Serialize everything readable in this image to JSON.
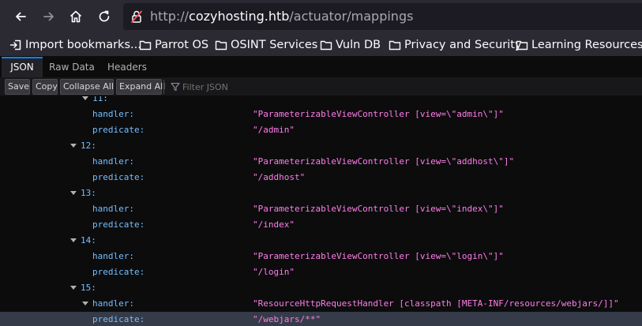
{
  "browser": {
    "url_scheme": "http://",
    "url_host": "cozyhosting.htb",
    "url_path": "/actuator/mappings"
  },
  "bookmarks": [
    {
      "label": "Import bookmarks...",
      "icon": "import-icon"
    },
    {
      "label": "Parrot OS",
      "icon": "folder-icon"
    },
    {
      "label": "OSINT Services",
      "icon": "folder-icon"
    },
    {
      "label": "Vuln DB",
      "icon": "folder-icon"
    },
    {
      "label": "Privacy and Security",
      "icon": "folder-icon"
    },
    {
      "label": "Learning Resources",
      "icon": "folder-icon"
    }
  ],
  "tabs": [
    {
      "label": "JSON",
      "active": true
    },
    {
      "label": "Raw Data",
      "active": false
    },
    {
      "label": "Headers",
      "active": false
    }
  ],
  "toolbar": {
    "save": "Save",
    "copy": "Copy",
    "collapse_all": "Collapse All",
    "expand_all": "Expand All",
    "filter_placeholder": "Filter JSON"
  },
  "tree": {
    "rows": [
      {
        "key": "11:",
        "value": "",
        "level": 0,
        "twisty": true,
        "selected": false
      },
      {
        "key": "handler:",
        "value": "\"ParameterizableViewController [view=\\\"admin\\\"]\"",
        "level": 1,
        "twisty": false,
        "selected": false
      },
      {
        "key": "predicate:",
        "value": "\"/admin\"",
        "level": 1,
        "twisty": false,
        "selected": false
      },
      {
        "key": "12:",
        "value": "",
        "level": 0,
        "twisty": true,
        "selected": false
      },
      {
        "key": "handler:",
        "value": "\"ParameterizableViewController [view=\\\"addhost\\\"]\"",
        "level": 1,
        "twisty": false,
        "selected": false
      },
      {
        "key": "predicate:",
        "value": "\"/addhost\"",
        "level": 1,
        "twisty": false,
        "selected": false
      },
      {
        "key": "13:",
        "value": "",
        "level": 0,
        "twisty": true,
        "selected": false
      },
      {
        "key": "handler:",
        "value": "\"ParameterizableViewController [view=\\\"index\\\"]\"",
        "level": 1,
        "twisty": false,
        "selected": false
      },
      {
        "key": "predicate:",
        "value": "\"/index\"",
        "level": 1,
        "twisty": false,
        "selected": false
      },
      {
        "key": "14:",
        "value": "",
        "level": 0,
        "twisty": true,
        "selected": false
      },
      {
        "key": "handler:",
        "value": "\"ParameterizableViewController [view=\\\"login\\\"]\"",
        "level": 1,
        "twisty": false,
        "selected": false
      },
      {
        "key": "predicate:",
        "value": "\"/login\"",
        "level": 1,
        "twisty": false,
        "selected": false
      },
      {
        "key": "15:",
        "value": "",
        "level": 0,
        "twisty": true,
        "selected": false
      },
      {
        "key": "handler:",
        "value": "\"ResourceHttpRequestHandler [classpath [META-INF/resources/webjars/]]\"",
        "level": 1,
        "twisty": true,
        "selected": false
      },
      {
        "key": "predicate:",
        "value": "\"/webjars/**\"",
        "level": 1,
        "twisty": false,
        "selected": true
      }
    ]
  }
}
